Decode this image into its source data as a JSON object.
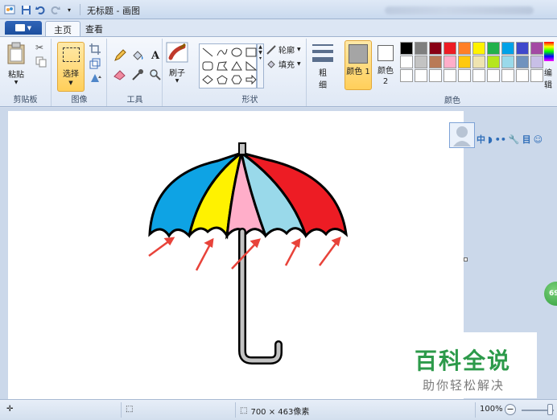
{
  "window": {
    "title": "无标题 - 画图"
  },
  "tabs": [
    {
      "label": "主页"
    },
    {
      "label": "查看"
    }
  ],
  "ribbon": {
    "clipboard": {
      "paste_label": "粘贴",
      "group_label": "剪贴板"
    },
    "image": {
      "select_label": "选择",
      "group_label": "图像"
    },
    "tools": {
      "group_label": "工具"
    },
    "brushes": {
      "label": "刷子"
    },
    "shapes": {
      "outline_label": "轮廓",
      "fill_label": "填充",
      "group_label": "形状"
    },
    "size": {
      "label": "粗细"
    },
    "color1": {
      "label": "颜色 1"
    },
    "color2": {
      "label": "颜色 2"
    },
    "colors": {
      "group_label": "颜色",
      "edit_label": "编辑"
    }
  },
  "palette": [
    "#000000",
    "#7f7f7f",
    "#880015",
    "#ed1c24",
    "#ff7f27",
    "#fff200",
    "#22b14c",
    "#00a2e8",
    "#3f48cc",
    "#a349a4",
    "#ffffff",
    "#c3c3c3",
    "#b97a57",
    "#ffaec9",
    "#ffc90e",
    "#efe4b0",
    "#b5e61d",
    "#99d9ea",
    "#7092be",
    "#c8bfe7",
    "#ffffff",
    "#ffffff",
    "#ffffff",
    "#ffffff",
    "#ffffff",
    "#ffffff",
    "#ffffff",
    "#ffffff",
    "#ffffff",
    "#ffffff"
  ],
  "canvas": {
    "umbrella_colors": {
      "blue": "#0ea3e4",
      "yellow": "#fff200",
      "pink": "#ffaec9",
      "light_blue": "#99d9ea",
      "red": "#ed1c24",
      "handle": "#c3c3c3"
    }
  },
  "side_toolbar": {
    "ime": [
      "中",
      "◗",
      "••",
      "🔧",
      "目",
      "☺"
    ]
  },
  "badge": {
    "text": "69"
  },
  "watermark": {
    "title": "百科全说",
    "subtitle": "助你轻松解决"
  },
  "status": {
    "dimensions": "700 × 463像素",
    "zoom": "100%"
  }
}
